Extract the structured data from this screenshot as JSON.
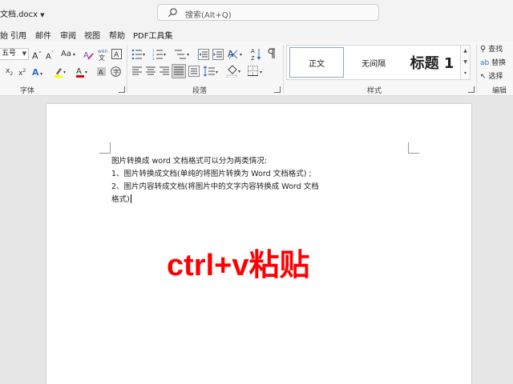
{
  "titlebar": {
    "doc_name": "文档.docx",
    "search_placeholder": "搜索(Alt+Q)"
  },
  "menu": {
    "tabs": [
      "始",
      "引用",
      "邮件",
      "审阅",
      "视图",
      "帮助",
      "PDF工具集"
    ]
  },
  "ribbon": {
    "font": {
      "size_value": "五号",
      "group_label": "字体",
      "case_label": "Aa",
      "grow_label": "A",
      "shrink_label": "A"
    },
    "paragraph": {
      "group_label": "段落"
    },
    "styles": {
      "group_label": "样式",
      "items": [
        "正文",
        "无间隔",
        "标题 1"
      ]
    },
    "editing": {
      "group_label": "编辑",
      "find_label": "查找",
      "replace_label": "替换",
      "select_label": "选择"
    }
  },
  "document": {
    "lines": [
      "图片转换成 word 文档格式可以分为两类情况:",
      "1、图片转换成文档(单纯的将图片转换为 Word 文档格式) ;",
      "2、图片内容转成文档(将图片中的文字内容转换成 Word 文档",
      "格式)"
    ],
    "overlay_text": "ctrl+v粘贴"
  },
  "colors": {
    "overlay": "#ff0000",
    "highlight": "#ffff00",
    "font_color": "#e00000"
  }
}
